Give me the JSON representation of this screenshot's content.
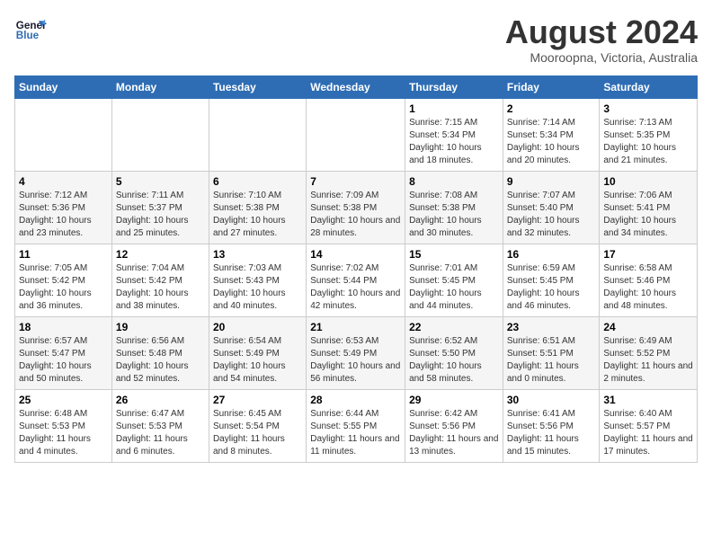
{
  "header": {
    "logo_line1": "General",
    "logo_line2": "Blue",
    "month": "August 2024",
    "location": "Mooroopna, Victoria, Australia"
  },
  "days_of_week": [
    "Sunday",
    "Monday",
    "Tuesday",
    "Wednesday",
    "Thursday",
    "Friday",
    "Saturday"
  ],
  "weeks": [
    [
      {
        "day": "",
        "sunrise": "",
        "sunset": "",
        "daylight": ""
      },
      {
        "day": "",
        "sunrise": "",
        "sunset": "",
        "daylight": ""
      },
      {
        "day": "",
        "sunrise": "",
        "sunset": "",
        "daylight": ""
      },
      {
        "day": "",
        "sunrise": "",
        "sunset": "",
        "daylight": ""
      },
      {
        "day": "1",
        "sunrise": "Sunrise: 7:15 AM",
        "sunset": "Sunset: 5:34 PM",
        "daylight": "Daylight: 10 hours and 18 minutes."
      },
      {
        "day": "2",
        "sunrise": "Sunrise: 7:14 AM",
        "sunset": "Sunset: 5:34 PM",
        "daylight": "Daylight: 10 hours and 20 minutes."
      },
      {
        "day": "3",
        "sunrise": "Sunrise: 7:13 AM",
        "sunset": "Sunset: 5:35 PM",
        "daylight": "Daylight: 10 hours and 21 minutes."
      }
    ],
    [
      {
        "day": "4",
        "sunrise": "Sunrise: 7:12 AM",
        "sunset": "Sunset: 5:36 PM",
        "daylight": "Daylight: 10 hours and 23 minutes."
      },
      {
        "day": "5",
        "sunrise": "Sunrise: 7:11 AM",
        "sunset": "Sunset: 5:37 PM",
        "daylight": "Daylight: 10 hours and 25 minutes."
      },
      {
        "day": "6",
        "sunrise": "Sunrise: 7:10 AM",
        "sunset": "Sunset: 5:38 PM",
        "daylight": "Daylight: 10 hours and 27 minutes."
      },
      {
        "day": "7",
        "sunrise": "Sunrise: 7:09 AM",
        "sunset": "Sunset: 5:38 PM",
        "daylight": "Daylight: 10 hours and 28 minutes."
      },
      {
        "day": "8",
        "sunrise": "Sunrise: 7:08 AM",
        "sunset": "Sunset: 5:38 PM",
        "daylight": "Daylight: 10 hours and 30 minutes."
      },
      {
        "day": "9",
        "sunrise": "Sunrise: 7:07 AM",
        "sunset": "Sunset: 5:40 PM",
        "daylight": "Daylight: 10 hours and 32 minutes."
      },
      {
        "day": "10",
        "sunrise": "Sunrise: 7:06 AM",
        "sunset": "Sunset: 5:41 PM",
        "daylight": "Daylight: 10 hours and 34 minutes."
      }
    ],
    [
      {
        "day": "11",
        "sunrise": "Sunrise: 7:05 AM",
        "sunset": "Sunset: 5:42 PM",
        "daylight": "Daylight: 10 hours and 36 minutes."
      },
      {
        "day": "12",
        "sunrise": "Sunrise: 7:04 AM",
        "sunset": "Sunset: 5:42 PM",
        "daylight": "Daylight: 10 hours and 38 minutes."
      },
      {
        "day": "13",
        "sunrise": "Sunrise: 7:03 AM",
        "sunset": "Sunset: 5:43 PM",
        "daylight": "Daylight: 10 hours and 40 minutes."
      },
      {
        "day": "14",
        "sunrise": "Sunrise: 7:02 AM",
        "sunset": "Sunset: 5:44 PM",
        "daylight": "Daylight: 10 hours and 42 minutes."
      },
      {
        "day": "15",
        "sunrise": "Sunrise: 7:01 AM",
        "sunset": "Sunset: 5:45 PM",
        "daylight": "Daylight: 10 hours and 44 minutes."
      },
      {
        "day": "16",
        "sunrise": "Sunrise: 6:59 AM",
        "sunset": "Sunset: 5:45 PM",
        "daylight": "Daylight: 10 hours and 46 minutes."
      },
      {
        "day": "17",
        "sunrise": "Sunrise: 6:58 AM",
        "sunset": "Sunset: 5:46 PM",
        "daylight": "Daylight: 10 hours and 48 minutes."
      }
    ],
    [
      {
        "day": "18",
        "sunrise": "Sunrise: 6:57 AM",
        "sunset": "Sunset: 5:47 PM",
        "daylight": "Daylight: 10 hours and 50 minutes."
      },
      {
        "day": "19",
        "sunrise": "Sunrise: 6:56 AM",
        "sunset": "Sunset: 5:48 PM",
        "daylight": "Daylight: 10 hours and 52 minutes."
      },
      {
        "day": "20",
        "sunrise": "Sunrise: 6:54 AM",
        "sunset": "Sunset: 5:49 PM",
        "daylight": "Daylight: 10 hours and 54 minutes."
      },
      {
        "day": "21",
        "sunrise": "Sunrise: 6:53 AM",
        "sunset": "Sunset: 5:49 PM",
        "daylight": "Daylight: 10 hours and 56 minutes."
      },
      {
        "day": "22",
        "sunrise": "Sunrise: 6:52 AM",
        "sunset": "Sunset: 5:50 PM",
        "daylight": "Daylight: 10 hours and 58 minutes."
      },
      {
        "day": "23",
        "sunrise": "Sunrise: 6:51 AM",
        "sunset": "Sunset: 5:51 PM",
        "daylight": "Daylight: 11 hours and 0 minutes."
      },
      {
        "day": "24",
        "sunrise": "Sunrise: 6:49 AM",
        "sunset": "Sunset: 5:52 PM",
        "daylight": "Daylight: 11 hours and 2 minutes."
      }
    ],
    [
      {
        "day": "25",
        "sunrise": "Sunrise: 6:48 AM",
        "sunset": "Sunset: 5:53 PM",
        "daylight": "Daylight: 11 hours and 4 minutes."
      },
      {
        "day": "26",
        "sunrise": "Sunrise: 6:47 AM",
        "sunset": "Sunset: 5:53 PM",
        "daylight": "Daylight: 11 hours and 6 minutes."
      },
      {
        "day": "27",
        "sunrise": "Sunrise: 6:45 AM",
        "sunset": "Sunset: 5:54 PM",
        "daylight": "Daylight: 11 hours and 8 minutes."
      },
      {
        "day": "28",
        "sunrise": "Sunrise: 6:44 AM",
        "sunset": "Sunset: 5:55 PM",
        "daylight": "Daylight: 11 hours and 11 minutes."
      },
      {
        "day": "29",
        "sunrise": "Sunrise: 6:42 AM",
        "sunset": "Sunset: 5:56 PM",
        "daylight": "Daylight: 11 hours and 13 minutes."
      },
      {
        "day": "30",
        "sunrise": "Sunrise: 6:41 AM",
        "sunset": "Sunset: 5:56 PM",
        "daylight": "Daylight: 11 hours and 15 minutes."
      },
      {
        "day": "31",
        "sunrise": "Sunrise: 6:40 AM",
        "sunset": "Sunset: 5:57 PM",
        "daylight": "Daylight: 11 hours and 17 minutes."
      }
    ]
  ]
}
